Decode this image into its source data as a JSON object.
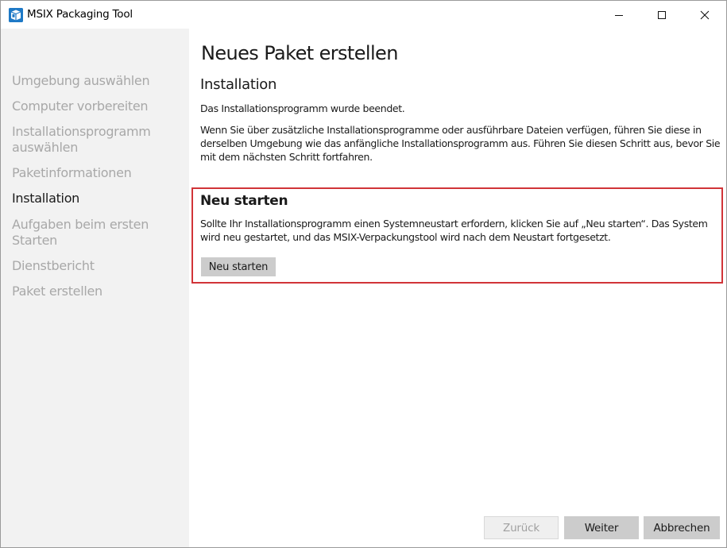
{
  "window": {
    "title": "MSIX Packaging Tool",
    "app_icon": "msix-package-icon",
    "controls": {
      "minimize_icon": "minimize-icon",
      "maximize_icon": "maximize-icon",
      "close_icon": "close-icon"
    }
  },
  "sidebar": {
    "items": [
      {
        "label": "Umgebung auswählen",
        "active": false
      },
      {
        "label": "Computer vorbereiten",
        "active": false
      },
      {
        "label": "Installationsprogramm auswählen",
        "active": false
      },
      {
        "label": "Paketinformationen",
        "active": false
      },
      {
        "label": "Installation",
        "active": true
      },
      {
        "label": "Aufgaben beim ersten Starten",
        "active": false
      },
      {
        "label": "Dienstbericht",
        "active": false
      },
      {
        "label": "Paket erstellen",
        "active": false
      }
    ]
  },
  "main": {
    "page_title": "Neues Paket erstellen",
    "section_title": "Installation",
    "paragraph_1": "Das Installationsprogramm wurde beendet.",
    "paragraph_2": "Wenn Sie über zusätzliche Installationsprogramme oder ausführbare Dateien verfügen, führen Sie diese in derselben Umgebung wie das anfängliche Installationsprogramm aus. Führen Sie diesen Schritt aus, bevor Sie mit dem nächsten Schritt fortfahren.",
    "restart": {
      "title": "Neu starten",
      "text": "Sollte Ihr Installationsprogramm einen Systemneustart erfordern, klicken Sie auf „Neu starten“. Das System wird neu gestartet, und das MSIX-Verpackungstool wird nach dem Neustart fortgesetzt.",
      "button_label": "Neu starten"
    }
  },
  "footer": {
    "back_label": "Zurück",
    "back_enabled": false,
    "next_label": "Weiter",
    "cancel_label": "Abbrechen"
  },
  "colors": {
    "accent_box_border": "#d13438",
    "sidebar_bg": "#f2f2f2",
    "app_icon_blue": "#1e79c6",
    "inactive_nav_text": "#a8a8a8"
  }
}
